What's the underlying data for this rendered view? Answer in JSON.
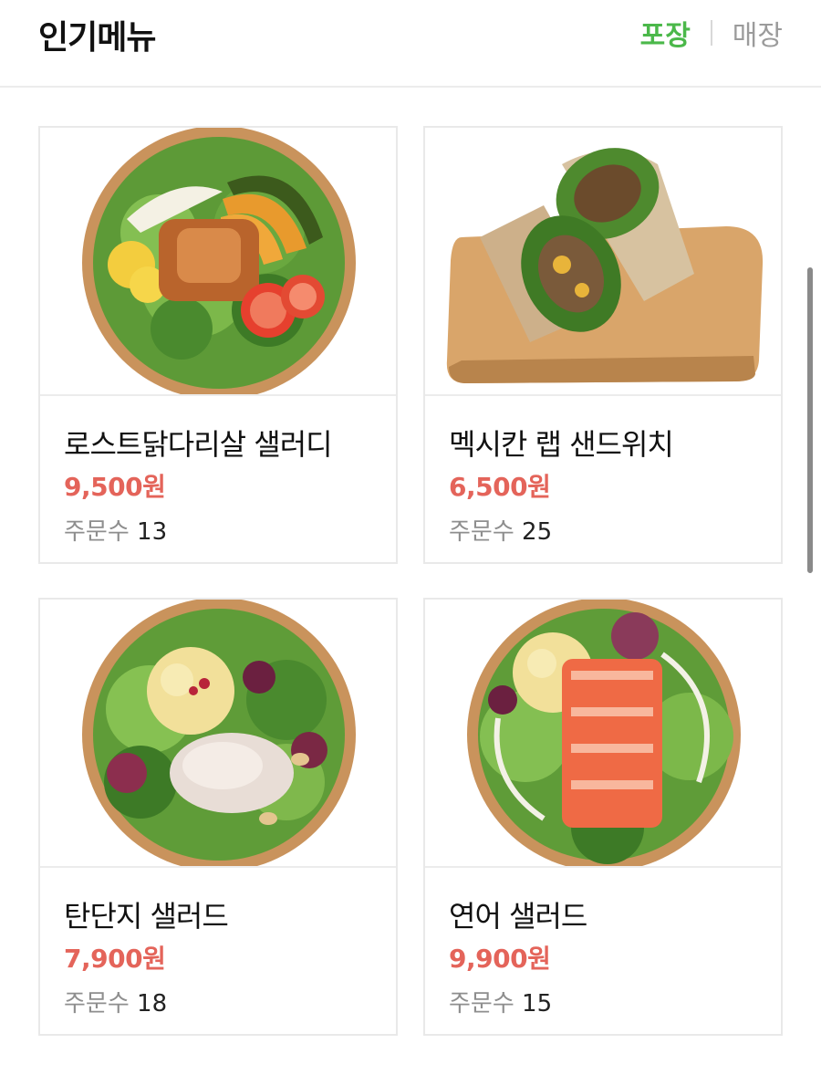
{
  "header": {
    "title": "인기메뉴",
    "tabs": [
      {
        "label": "포장",
        "active": true
      },
      {
        "label": "매장",
        "active": false
      }
    ]
  },
  "menu": [
    {
      "name": "로스트닭다리살 샐러디",
      "price": "9,500원",
      "orders_label": "주문수",
      "orders": "13",
      "image": "roast-chicken-salad-bowl"
    },
    {
      "name": "멕시칸 랩 샌드위치",
      "price": "6,500원",
      "orders_label": "주문수",
      "orders": "25",
      "image": "mexican-wrap-on-board"
    },
    {
      "name": "탄단지 샐러드",
      "price": "7,900원",
      "orders_label": "주문수",
      "orders": "18",
      "image": "tandanji-salad-bowl"
    },
    {
      "name": "연어 샐러드",
      "price": "9,900원",
      "orders_label": "주문수",
      "orders": "15",
      "image": "salmon-salad-bowl"
    }
  ],
  "colors": {
    "accent_green": "#4bb84a",
    "price_red": "#e4645a",
    "muted_gray": "#9b9b9b"
  }
}
